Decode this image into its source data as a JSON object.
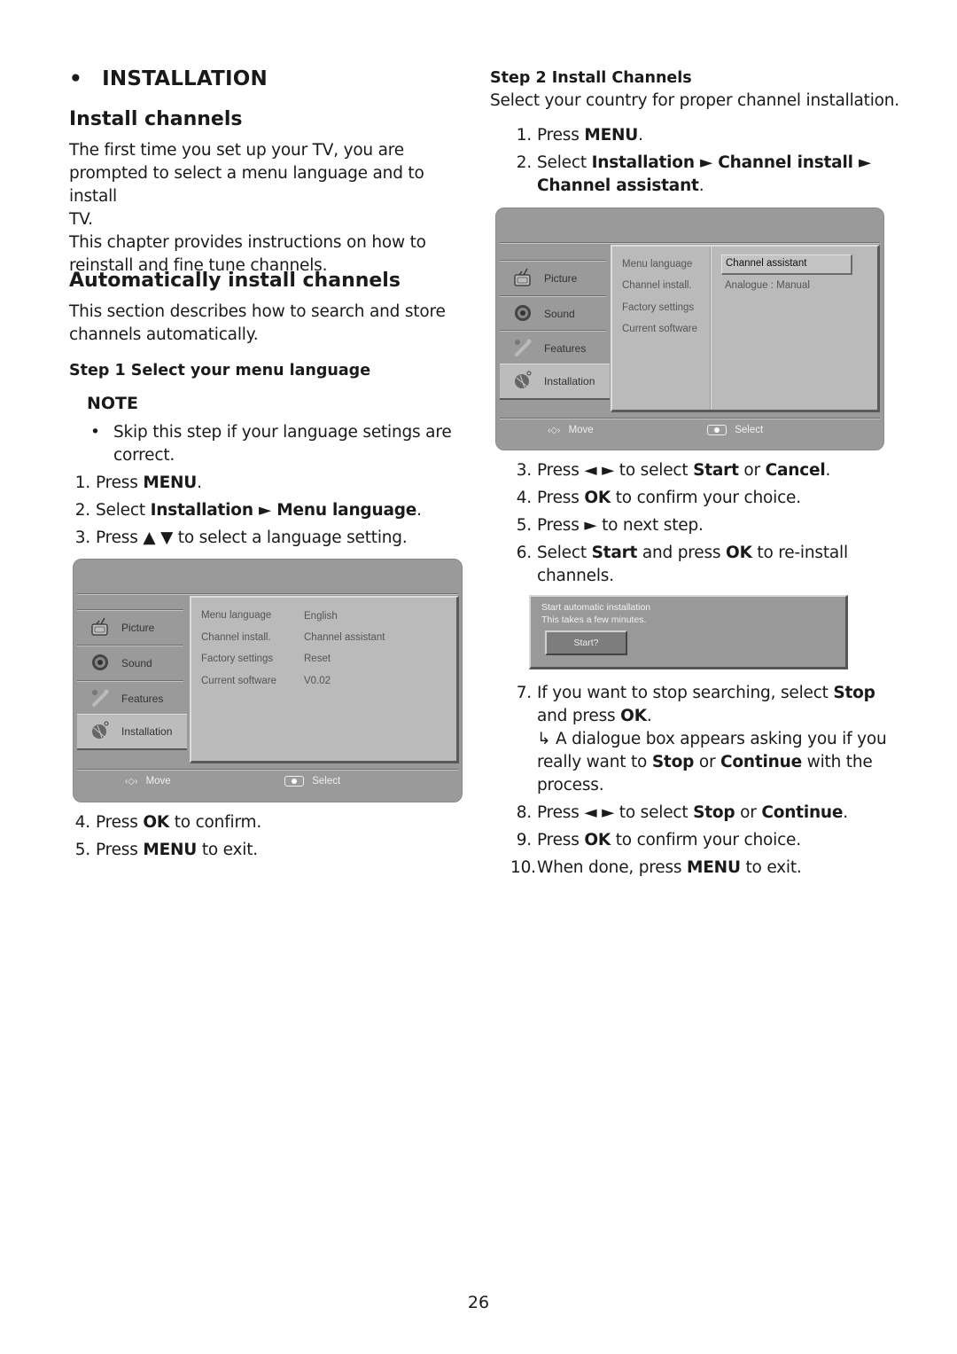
{
  "left": {
    "section_bullet": "•",
    "section_title": "INSTALLATION",
    "h_install": "Install channels",
    "intro_lines": [
      "The first time you set up your TV, you are",
      "prompted to select a menu language and to install",
      "TV.",
      "This chapter provides instructions on how to",
      "reinstall and fine tune channels."
    ],
    "h_auto": "Automatically install channels",
    "auto_lines": [
      "This section describes how to search and store",
      "channels automatically."
    ],
    "step1_title": "Step 1 Select your menu language",
    "note_title": "NOTE",
    "note_bullet": "•",
    "note_lines": [
      "Skip this step if your language setings are",
      "correct."
    ],
    "steps": [
      {
        "num": "1.",
        "pre": "Press ",
        "bold": "MENU",
        "post": "."
      },
      {
        "num": "2.",
        "pre": "Select ",
        "bold": "Installation ► Menu language",
        "post": "."
      },
      {
        "num": "3.",
        "pre": "Press ▲ ▼ to select a language setting.",
        "bold": "",
        "post": ""
      }
    ],
    "steps_after": [
      {
        "num": "4.",
        "pre": "Press ",
        "bold": "OK",
        "post": " to confirm."
      },
      {
        "num": "5.",
        "pre": "Press ",
        "bold": "MENU",
        "post": " to exit."
      }
    ],
    "tv_menu": {
      "sidebar": [
        "Picture",
        "Sound",
        "Features",
        "Installation"
      ],
      "active": "Installation",
      "rows": [
        {
          "label": "Menu language",
          "value": "English"
        },
        {
          "label": "Channel install.",
          "value": "Channel assistant"
        },
        {
          "label": "Factory settings",
          "value": "Reset"
        },
        {
          "label": "Current software",
          "value": "V0.02"
        }
      ],
      "footer_move": "Move",
      "footer_select": "Select"
    }
  },
  "right": {
    "step2_title": "Step 2 Install Channels",
    "step2_intro": "Select your country for proper channel installation.",
    "steps_a": [
      {
        "num": "1.",
        "pre": "Press ",
        "bold": "MENU",
        "post": "."
      },
      {
        "num": "2.",
        "pre": "Select ",
        "bold": "Installation ► Channel install ►",
        "post": ""
      }
    ],
    "step2_cont_bold": "Channel assistant",
    "step2_cont_post": ".",
    "tv_menu": {
      "sidebar": [
        "Picture",
        "Sound",
        "Features",
        "Installation"
      ],
      "active": "Installation",
      "rows": [
        "Menu language",
        "Channel install.",
        "Factory settings",
        "Current software"
      ],
      "options": [
        "Channel assistant",
        "Analogue : Manual"
      ],
      "selected_option": "Channel assistant",
      "footer_move": "Move",
      "footer_select": "Select"
    },
    "steps_b": [
      {
        "num": "3.",
        "pre": "Press ◄ ► to select ",
        "b1": "Start",
        "mid": " or ",
        "b2": "Cancel",
        "post": "."
      },
      {
        "num": "4.",
        "pre": "Press ",
        "b1": "OK",
        "mid": " to confirm your choice.",
        "b2": "",
        "post": ""
      },
      {
        "num": "5.",
        "pre": "Press ► to next step.",
        "b1": "",
        "mid": "",
        "b2": "",
        "post": ""
      },
      {
        "num": "6.",
        "pre": "Select ",
        "b1": "Start",
        "mid": " and press ",
        "b2": "OK",
        "post": " to re-install"
      }
    ],
    "step6_cont": "channels.",
    "dialog": {
      "line1": "Start automatic installation",
      "line2": "This takes a few minutes.",
      "button": "Start?"
    },
    "step7": {
      "num": "7.",
      "pre": "If you want to stop searching, select ",
      "b1": "Stop"
    },
    "step7_l2": {
      "pre": "and press ",
      "b1": "OK",
      "post": "."
    },
    "step7_l3": "↳ A dialogue box appears asking you if you",
    "step7_l4": {
      "pre": "really want to ",
      "b1": "Stop",
      "mid": " or ",
      "b2": "Continue",
      "post": " with the"
    },
    "step7_l5": "process.",
    "steps_c": [
      {
        "num": "8.",
        "pre": "Press ◄ ► to select ",
        "b1": "Stop",
        "mid": " or ",
        "b2": "Continue",
        "post": "."
      },
      {
        "num": "9.",
        "pre": "Press ",
        "b1": "OK",
        "mid": " to confirm your choice.",
        "b2": "",
        "post": ""
      },
      {
        "num": "10.",
        "pre": "When done, press ",
        "b1": "MENU",
        "mid": " to exit.",
        "b2": "",
        "post": ""
      }
    ]
  },
  "page_number": "26"
}
